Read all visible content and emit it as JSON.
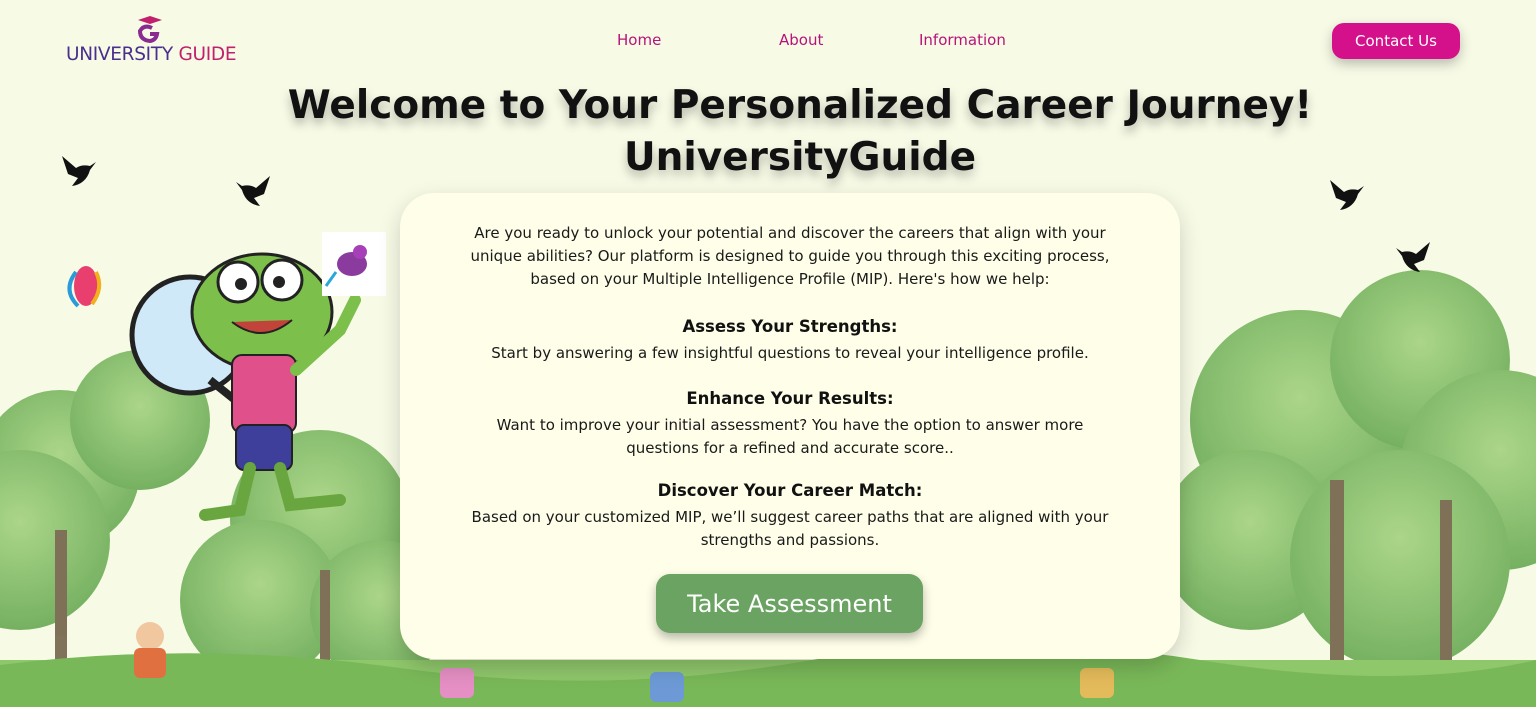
{
  "brand": {
    "word1": "UNIVERSITY",
    "word2": "GUIDE"
  },
  "nav": {
    "home": "Home",
    "about": "About",
    "information": "Information"
  },
  "header": {
    "contact_label": "Contact Us"
  },
  "hero": {
    "title_line1": "Welcome to Your Personalized Career Journey!",
    "title_line2": "UniversityGuide"
  },
  "card": {
    "intro": "Are you ready to unlock your potential and discover the careers that align with your unique abilities? Our platform is designed to guide you through this exciting process, based on your Multiple Intelligence Profile (MIP). Here's how we help:",
    "steps": [
      {
        "heading": "Assess Your Strengths:",
        "text": "Start by answering a few insightful questions to reveal your intelligence profile."
      },
      {
        "heading": "Enhance Your Results:",
        "text": "Want to improve your initial assessment? You have the option to answer more questions for a refined and accurate score.."
      },
      {
        "heading": "Discover Your Career Match:",
        "text": "Based on your customized MIP, we’ll suggest career paths that are aligned with your strengths and passions."
      }
    ],
    "cta_label": "Take Assessment"
  },
  "colors": {
    "accent": "#d4108a",
    "nav_text": "#b8127a",
    "cta": "#6aa362",
    "background": "#f7fbe6",
    "card": "#fefee9"
  },
  "icons": {
    "logo": "graduation-g-logo",
    "birds": "dove-silhouette-icon",
    "mascot": "frog-with-magnifier"
  }
}
